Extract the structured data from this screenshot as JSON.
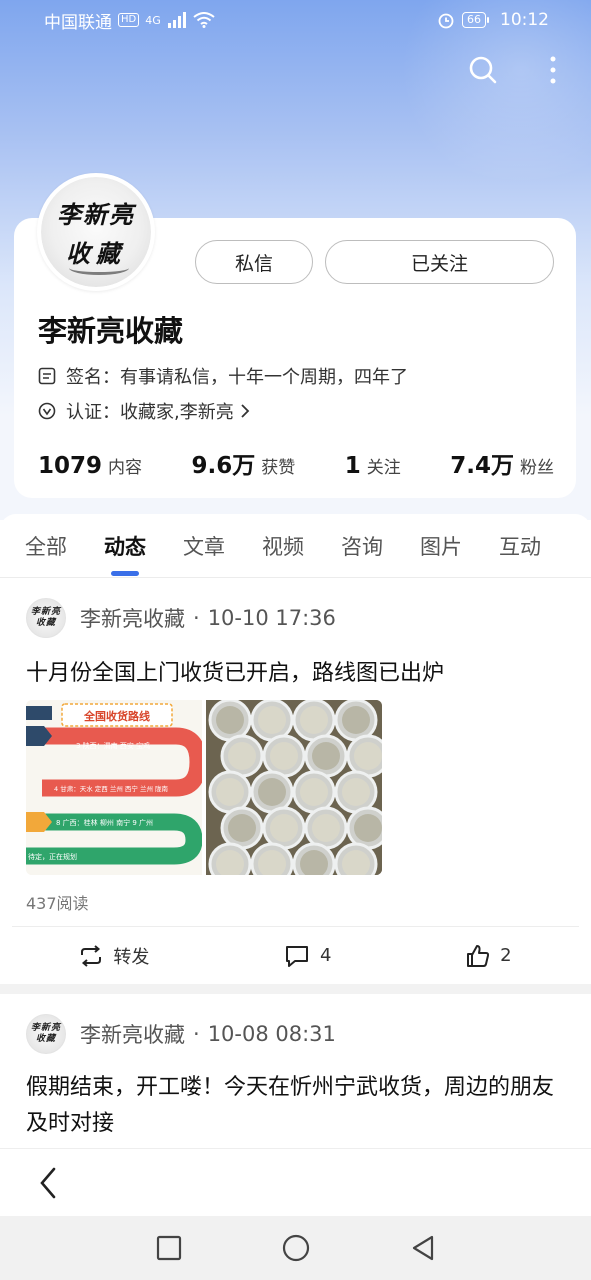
{
  "status_bar": {
    "carrier": "中国联通",
    "hd": "HD",
    "network": "4G",
    "battery": "66",
    "time": "10:12"
  },
  "header": {
    "icons": [
      "search-icon",
      "more-vertical-icon"
    ]
  },
  "profile": {
    "avatar_text_line1": "李新亮",
    "avatar_text_line2": "收藏",
    "message_button": "私信",
    "follow_button": "已关注",
    "name": "李新亮收藏",
    "signature_label": "签名：",
    "signature": "有事请私信，十年一个周期，四年了",
    "cert_label": "认证：",
    "cert": "收藏家,李新亮",
    "stats": [
      {
        "num": "1079",
        "label": "内容"
      },
      {
        "num": "9.6万",
        "label": "获赞"
      },
      {
        "num": "1",
        "label": "关注"
      },
      {
        "num": "7.4万",
        "label": "粉丝"
      }
    ]
  },
  "tabs": [
    "全部",
    "动态",
    "文章",
    "视频",
    "咨询",
    "图片",
    "互动"
  ],
  "active_tab": "动态",
  "posts": [
    {
      "author": "李新亮收藏",
      "time": "10-10 17:36",
      "text": "十月份全国上门收货已开启，路线图已出炉",
      "map_title": "全国收货路线",
      "map_line1": "3 陕西：渭南 西安 宝鸡",
      "map_line2": "4 甘肃：天水 定西 兰州 西宁 兰州 陇南",
      "map_line3": "8 广西：桂林 柳州 南宁   9 广州",
      "map_line4": "待定，正在规划",
      "reads": "437阅读",
      "repost": "转发",
      "comments": "4",
      "likes": "2"
    },
    {
      "author": "李新亮收藏",
      "time": "10-08 08:31",
      "text": "假期结束，开工喽！今天在忻州宁武收货，周边的朋友及时对接"
    }
  ],
  "colors": {
    "accent": "#3a6fe8",
    "header_gradient_top": "#7fa6ee"
  }
}
